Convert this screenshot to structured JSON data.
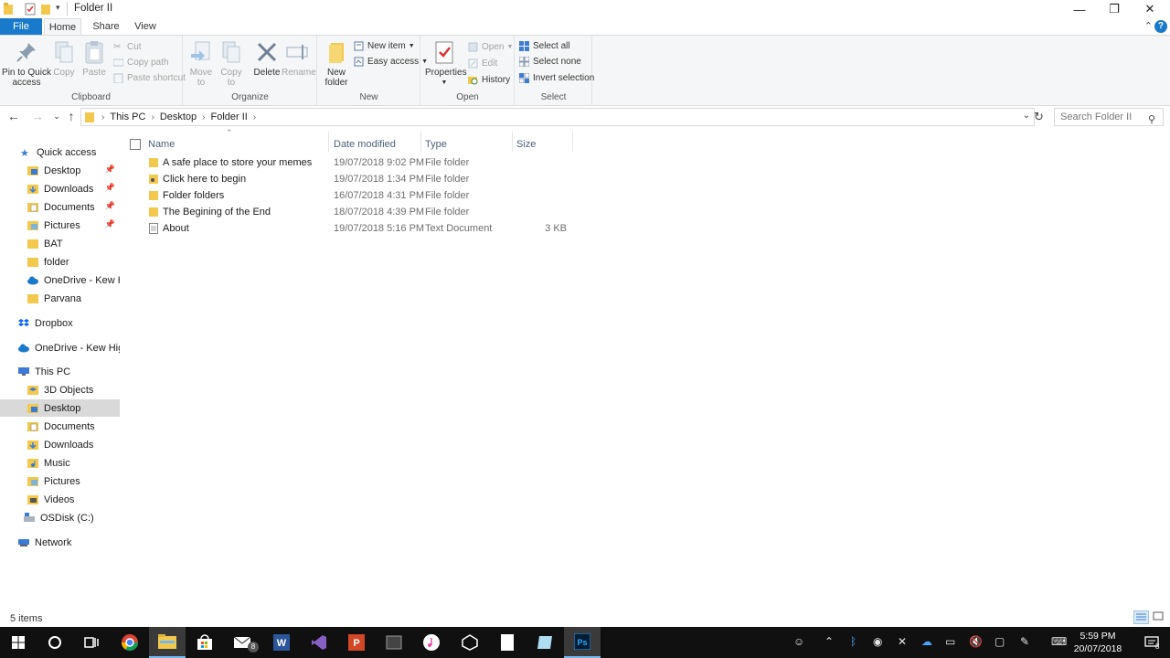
{
  "window": {
    "title": "Folder II",
    "minimize_glyph": "—",
    "restore_glyph": "❐",
    "close_glyph": "✕"
  },
  "ribbon_tabs": {
    "file": "File",
    "home": "Home",
    "share": "Share",
    "view": "View"
  },
  "ribbon": {
    "clipboard": {
      "label": "Clipboard",
      "pin": "Pin to Quick access",
      "copy": "Copy",
      "paste": "Paste",
      "cut": "Cut",
      "copy_path": "Copy path",
      "paste_shortcut": "Paste shortcut"
    },
    "organize": {
      "label": "Organize",
      "move_to": "Move to",
      "copy_to": "Copy to",
      "delete": "Delete",
      "rename": "Rename"
    },
    "new": {
      "label": "New",
      "new_folder": "New folder",
      "new_item": "New item",
      "easy_access": "Easy access"
    },
    "open": {
      "label": "Open",
      "properties": "Properties",
      "open": "Open",
      "edit": "Edit",
      "history": "History"
    },
    "select": {
      "label": "Select",
      "select_all": "Select all",
      "select_none": "Select none",
      "invert_selection": "Invert selection"
    }
  },
  "address": {
    "crumbs": [
      "This PC",
      "Desktop",
      "Folder II"
    ],
    "search_placeholder": "Search Folder II"
  },
  "nav_pane": {
    "quick_access": "Quick access",
    "quick_items": [
      "Desktop",
      "Downloads",
      "Documents",
      "Pictures",
      "BAT",
      "folder",
      "OneDrive - Kew High",
      "Parvana"
    ],
    "dropbox": "Dropbox",
    "onedrive": "OneDrive - Kew High",
    "this_pc": "This PC",
    "pc_items": [
      "3D Objects",
      "Desktop",
      "Documents",
      "Downloads",
      "Music",
      "Pictures",
      "Videos",
      "OSDisk (C:)"
    ],
    "network": "Network"
  },
  "columns": {
    "name": "Name",
    "date": "Date modified",
    "type": "Type",
    "size": "Size"
  },
  "files": [
    {
      "name": "A safe place to store your memes",
      "date": "19/07/2018 9:02 PM",
      "type": "File folder",
      "size": "",
      "icon": "folder-icon"
    },
    {
      "name": "Click here to begin",
      "date": "19/07/2018 1:34 PM",
      "type": "File folder",
      "size": "",
      "icon": "shared-folder-icon"
    },
    {
      "name": "Folder folders",
      "date": "16/07/2018 4:31 PM",
      "type": "File folder",
      "size": "",
      "icon": "folder-icon"
    },
    {
      "name": "The Begining of the End",
      "date": "18/07/2018 4:39 PM",
      "type": "File folder",
      "size": "",
      "icon": "folder-icon"
    },
    {
      "name": "About",
      "date": "19/07/2018 5:16 PM",
      "type": "Text Document",
      "size": "3 KB",
      "icon": "text-document-icon"
    }
  ],
  "status": {
    "item_count": "5 items"
  },
  "taskbar": {
    "time": "5:59 PM",
    "date": "20/07/2018",
    "notification_count": "8",
    "mail_badge": "8"
  },
  "colors": {
    "accent": "#1979ca",
    "folder": "#f2c94c",
    "taskbar": "#101010",
    "selected": "#d9d9d9"
  }
}
